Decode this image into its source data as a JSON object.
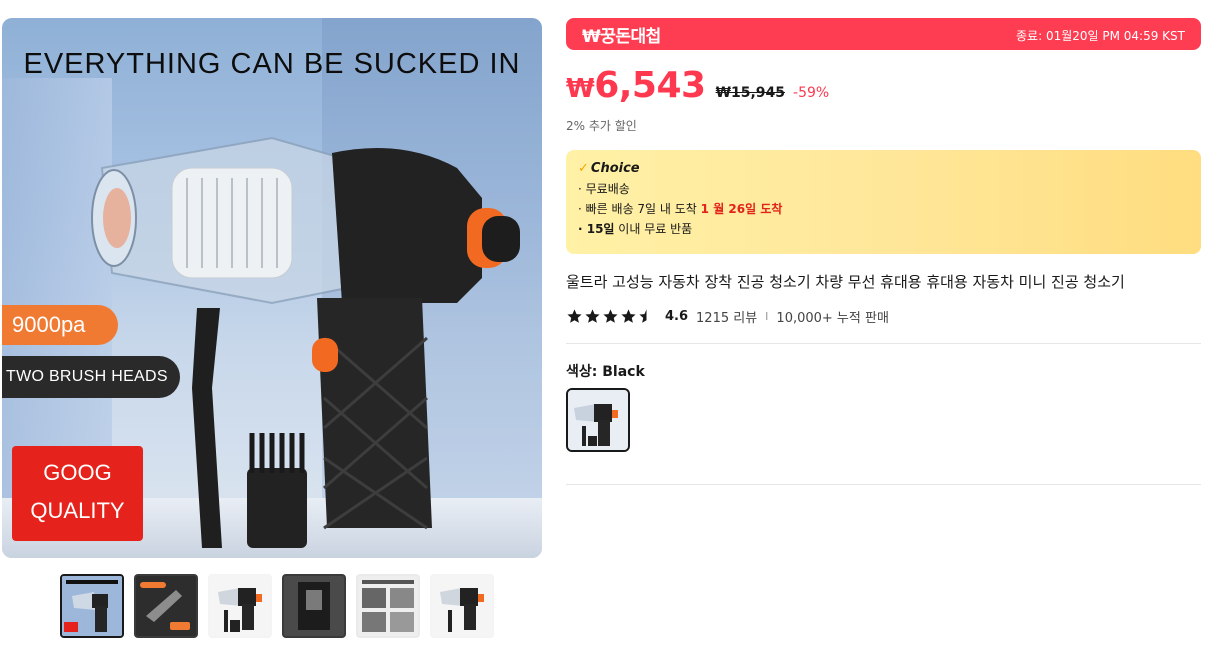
{
  "main_image": {
    "headline": "EVERYTHING CAN BE SUCKED IN",
    "badge_pressure": "9000pa",
    "badge_heads": "TWO BRUSH HEADS",
    "badge_quality_line1": "GOOG",
    "badge_quality_line2": "QUALITY"
  },
  "thumbnails": [
    {
      "name": "thumb-1",
      "active": true
    },
    {
      "name": "thumb-2",
      "active": false
    },
    {
      "name": "thumb-3",
      "active": false
    },
    {
      "name": "thumb-4",
      "active": false
    },
    {
      "name": "thumb-5",
      "active": false
    },
    {
      "name": "thumb-6",
      "active": false
    }
  ],
  "deal": {
    "logo": "₩꿍돈대첩",
    "end_time": "종료: 01월20일 PM 04:59 KST",
    "color": "#ff3d52"
  },
  "price": {
    "currency": "₩",
    "current": "6,543",
    "original": "₩15,945",
    "discount": "-59%",
    "extra_discount": "2% 추가 할인",
    "color": "#fd384f"
  },
  "choice": {
    "logo": "Choice",
    "line1": "· 무료배송",
    "line2_prefix": "· 빠른 배송 7일 내 도착 ",
    "line2_highlight": "1 월 26일 도착",
    "line3_bold": "· 15일",
    "line3_rest": " 이내  무료 반품"
  },
  "product": {
    "title": "울트라 고성능 자동차 장착 진공 청소기 차량 무선 휴대용 휴대용 자동차 미니 진공 청소기"
  },
  "rating": {
    "value": "4.6",
    "reviews": "1215 리뷰",
    "separator": "I",
    "sold": "10,000+ 누적 판매",
    "stars_filled": 4.5
  },
  "variant": {
    "label": "색상: ",
    "value": "Black"
  }
}
